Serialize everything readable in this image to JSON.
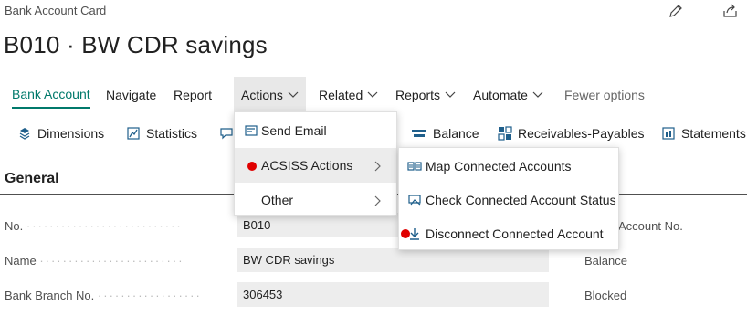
{
  "page": {
    "caption": "Bank Account Card",
    "title": "B010 · BW CDR savings",
    "edit_icon": "pencil-icon",
    "share_icon": "share-icon"
  },
  "menubar": {
    "items": [
      {
        "label": "Bank Account"
      },
      {
        "label": "Navigate"
      },
      {
        "label": "Report"
      },
      {
        "label": "Actions"
      },
      {
        "label": "Related"
      },
      {
        "label": "Reports"
      },
      {
        "label": "Automate"
      },
      {
        "label": "Fewer options"
      }
    ]
  },
  "toolbar": {
    "items": [
      {
        "label": "Dimensions",
        "icon": "dimensions-icon"
      },
      {
        "label": "Statistics",
        "icon": "statistics-icon"
      },
      {
        "label": "Balance",
        "icon": "balance-icon"
      },
      {
        "label": "Receivables-Payables",
        "icon": "receivables-icon"
      },
      {
        "label": "Statements",
        "icon": "statements-icon"
      }
    ]
  },
  "actions_menu": {
    "items": [
      {
        "label": "Send Email",
        "icon": "email-icon"
      },
      {
        "label": "ACSISS Actions"
      },
      {
        "label": "Other"
      }
    ]
  },
  "acsiss_submenu": {
    "items": [
      {
        "label": "Map Connected Accounts",
        "icon": "map-icon"
      },
      {
        "label": "Check Connected Account Status",
        "icon": "check-status-icon"
      },
      {
        "label": "Disconnect Connected Account",
        "icon": "disconnect-icon"
      }
    ]
  },
  "general": {
    "title": "General",
    "fields": [
      {
        "label": "No.",
        "value": "B010"
      },
      {
        "label": "Name",
        "value": "BW CDR savings"
      },
      {
        "label": "Bank Branch No.",
        "value": "306453"
      }
    ],
    "right_labels": [
      "Account No.",
      "Balance",
      "Blocked"
    ]
  },
  "colors": {
    "accent": "#00796b",
    "marker": "#e00000"
  }
}
